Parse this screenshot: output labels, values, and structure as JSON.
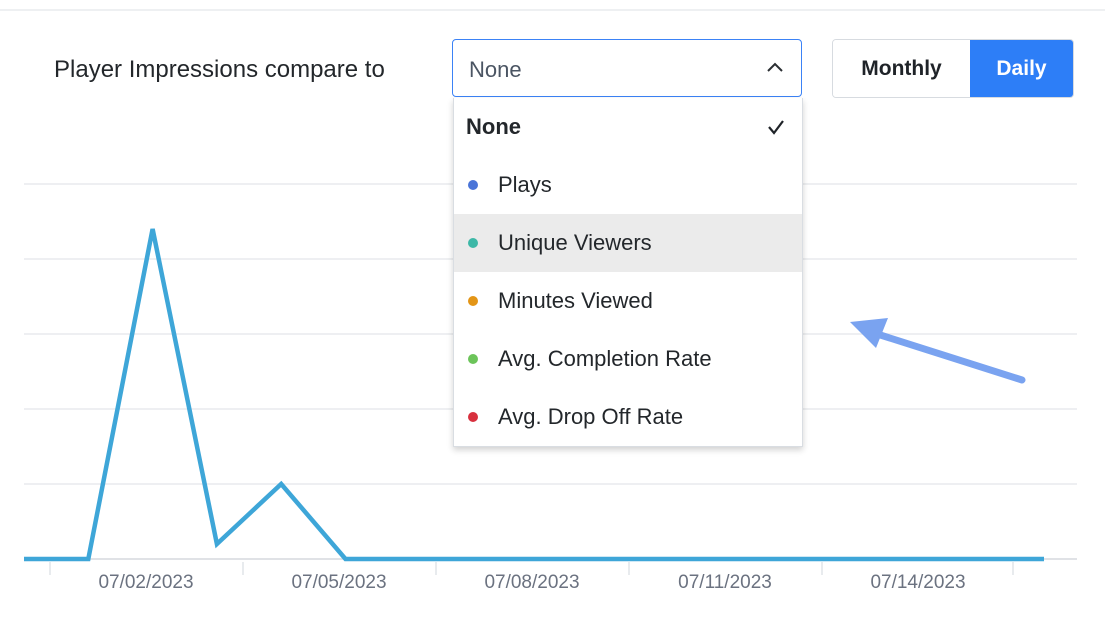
{
  "header": {
    "compare_label": "Player Impressions compare to",
    "select_value": "None",
    "toggle": {
      "monthly": "Monthly",
      "daily": "Daily",
      "active": "daily"
    }
  },
  "dropdown": {
    "items": [
      {
        "label": "None",
        "selected": true
      },
      {
        "label": "Plays",
        "color": "#4a74d8"
      },
      {
        "label": "Unique Viewers",
        "color": "#3db8a7",
        "hovered": true
      },
      {
        "label": "Minutes Viewed",
        "color": "#e39516"
      },
      {
        "label": "Avg. Completion Rate",
        "color": "#6cc45a"
      },
      {
        "label": "Avg. Drop Off Rate",
        "color": "#d8303e"
      }
    ]
  },
  "colors": {
    "accent": "#2d7ef7",
    "line": "#3ea6d8",
    "annotation_arrow": "#7aa3f0"
  },
  "chart_data": {
    "type": "line",
    "x_tick_labels": [
      "07/02/2023",
      "07/05/2023",
      "07/08/2023",
      "07/11/2023",
      "07/14/2023"
    ],
    "series": [
      {
        "color": "#3ea6d8",
        "x": [
          "06/30/2023",
          "07/01/2023",
          "07/02/2023",
          "07/03/2023",
          "07/04/2023",
          "07/05/2023",
          "07/06/2023",
          "07/07/2023",
          "07/08/2023",
          "07/09/2023",
          "07/10/2023",
          "07/11/2023",
          "07/12/2023",
          "07/13/2023",
          "07/14/2023",
          "07/15/2023"
        ],
        "values": [
          0,
          0,
          4.4,
          0.2,
          1.0,
          0,
          0,
          0,
          0,
          0,
          0,
          0,
          0,
          0,
          0,
          0
        ]
      }
    ],
    "grid": true,
    "ylim": [
      0,
      5
    ]
  }
}
